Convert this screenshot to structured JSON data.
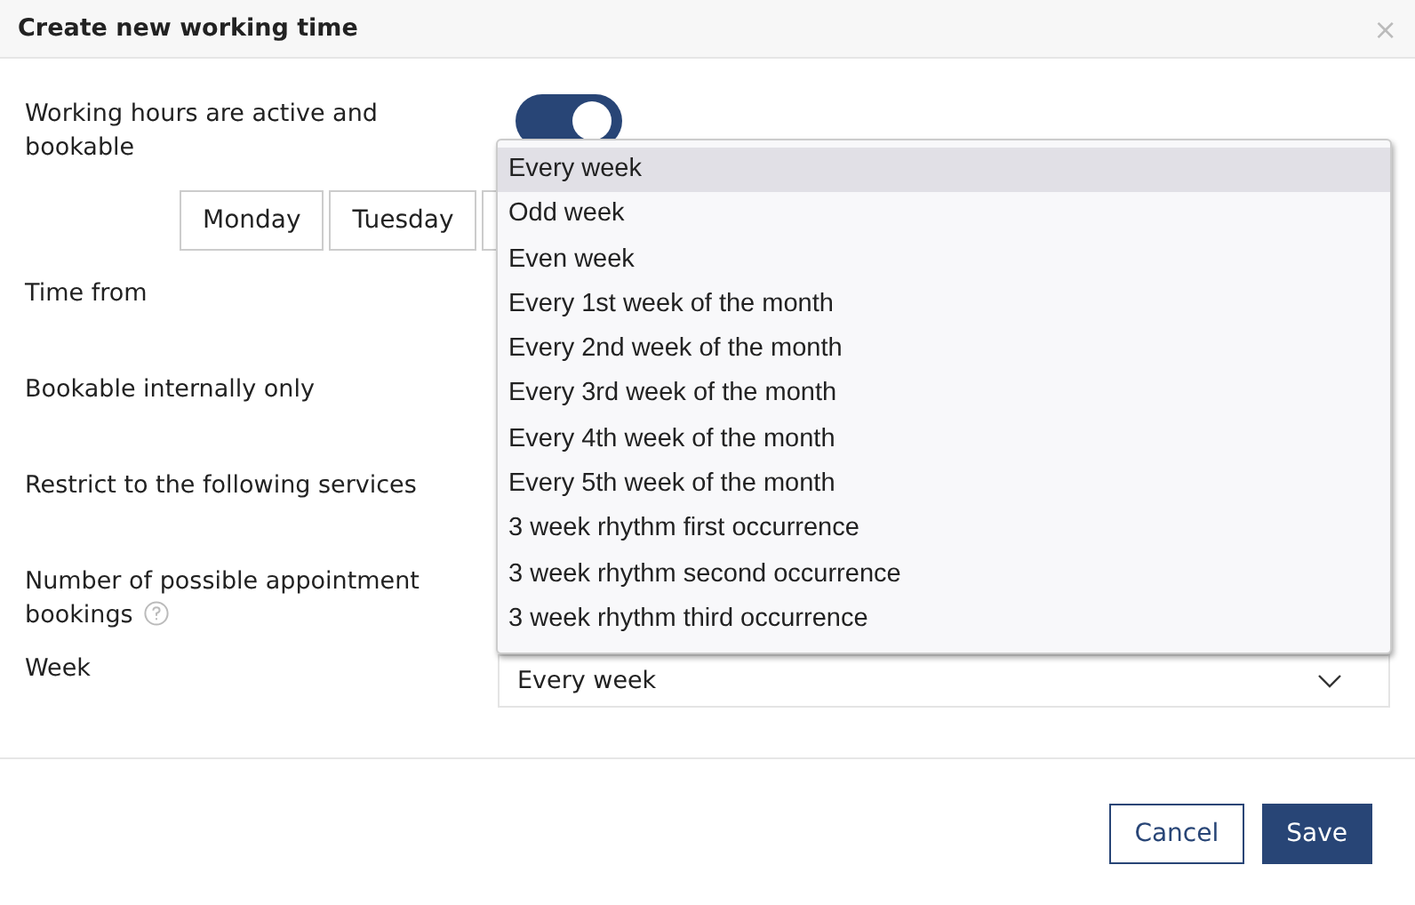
{
  "dialog": {
    "title": "Create new working time",
    "close": "×"
  },
  "fields": [
    {
      "kind": "toggle",
      "label": "Working hours are active and bookable",
      "on": true
    },
    {
      "kind": "days",
      "days": [
        "Monday",
        "Tuesday"
      ]
    },
    {
      "kind": "label",
      "label": "Time from"
    },
    {
      "kind": "label",
      "label": "Bookable internally only"
    },
    {
      "kind": "label",
      "label": "Restrict to the following services"
    },
    {
      "kind": "label",
      "label": "Number of possible appointment bookings",
      "help": true
    },
    {
      "kind": "select",
      "label": "Week",
      "value": "Every week"
    }
  ],
  "dropdown": {
    "options": [
      {
        "label": "Every week",
        "selected": true
      },
      {
        "label": "Odd week",
        "selected": false
      },
      {
        "label": "Even week",
        "selected": false
      },
      {
        "label": "Every 1st week of the month",
        "selected": false
      },
      {
        "label": "Every 2nd week of the month",
        "selected": false
      },
      {
        "label": "Every 3rd week of the month",
        "selected": false
      },
      {
        "label": "Every 4th week of the month",
        "selected": false
      },
      {
        "label": "Every 5th week of the month",
        "selected": false
      },
      {
        "label": "3 week rhythm first occurrence",
        "selected": false
      },
      {
        "label": "3 week rhythm second occurrence",
        "selected": false
      },
      {
        "label": "3 week rhythm third occurrence",
        "selected": false
      }
    ]
  },
  "buttons": [
    {
      "label": "Cancel",
      "kind": "secondary"
    },
    {
      "label": "Save",
      "kind": "primary"
    }
  ]
}
